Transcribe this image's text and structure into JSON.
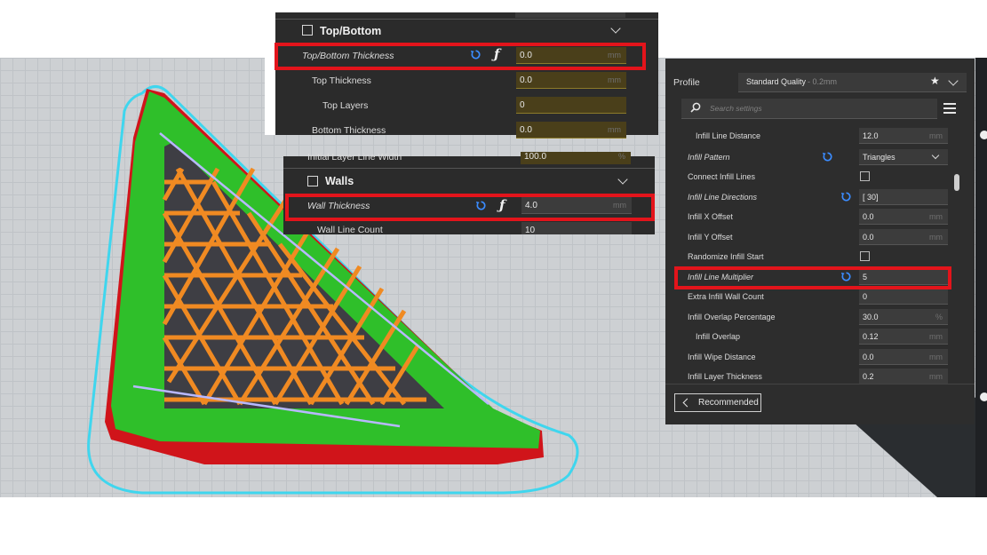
{
  "topbottom_panel": {
    "section_title": "Top/Bottom",
    "rows": [
      {
        "label": "Top/Bottom Thickness",
        "value": "0.0",
        "unit": "mm"
      },
      {
        "label": "Top Thickness",
        "value": "0.0",
        "unit": "mm"
      },
      {
        "label": "Top Layers",
        "value": "0",
        "unit": ""
      },
      {
        "label": "Bottom Thickness",
        "value": "0.0",
        "unit": "mm"
      }
    ]
  },
  "walls_panel": {
    "partial_row_label": "Initial Layer Line Width",
    "partial_row_value": "100.0",
    "partial_row_unit": "%",
    "section_title": "Walls",
    "rows": [
      {
        "label": "Wall Thickness",
        "value": "4.0",
        "unit": "mm"
      },
      {
        "label": "Wall Line Count",
        "value": "10",
        "unit": ""
      }
    ]
  },
  "settings_panel": {
    "profile_label": "Profile",
    "profile_value": "Standard Quality",
    "profile_suffix": " - 0.2mm",
    "search_placeholder": "Search settings",
    "rows": [
      {
        "label": "Infill Line Distance",
        "value": "12.0",
        "unit": "mm"
      },
      {
        "label": "Infill Pattern",
        "value": "Triangles",
        "unit": ""
      },
      {
        "label": "Connect Infill Lines",
        "value": "",
        "unit": ""
      },
      {
        "label": "Infill Line Directions",
        "value": "[ 30]",
        "unit": ""
      },
      {
        "label": "Infill X Offset",
        "value": "0.0",
        "unit": "mm"
      },
      {
        "label": "Infill Y Offset",
        "value": "0.0",
        "unit": "mm"
      },
      {
        "label": "Randomize Infill Start",
        "value": "",
        "unit": ""
      },
      {
        "label": "Infill Line Multiplier",
        "value": "5",
        "unit": ""
      },
      {
        "label": "Extra Infill Wall Count",
        "value": "0",
        "unit": ""
      },
      {
        "label": "Infill Overlap Percentage",
        "value": "30.0",
        "unit": "%"
      },
      {
        "label": "Infill Overlap",
        "value": "0.12",
        "unit": "mm"
      },
      {
        "label": "Infill Wipe Distance",
        "value": "0.0",
        "unit": "mm"
      },
      {
        "label": "Infill Layer Thickness",
        "value": "0.2",
        "unit": "mm"
      }
    ],
    "recommended_label": "Recommended"
  },
  "colors": {
    "highlight": "#e3141b",
    "accent": "#3b8cff",
    "panel": "#2b2b2b"
  }
}
